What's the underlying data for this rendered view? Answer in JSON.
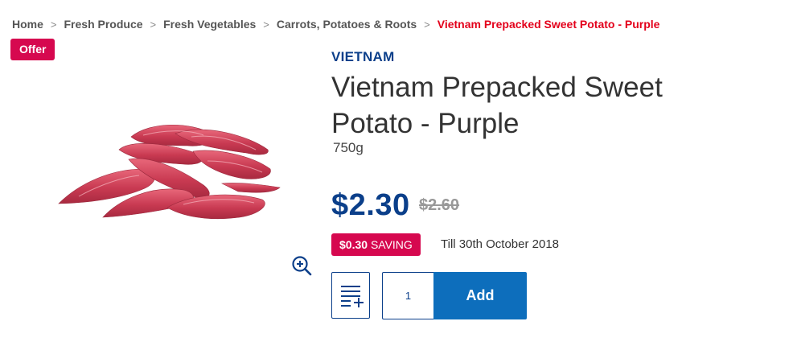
{
  "breadcrumb": {
    "items": [
      "Home",
      "Fresh Produce",
      "Fresh Vegetables",
      "Carrots, Potatoes & Roots"
    ],
    "current": "Vietnam Prepacked Sweet Potato - Purple",
    "separator": ">"
  },
  "offer_badge": "Offer",
  "product": {
    "origin": "VIETNAM",
    "title": "Vietnam Prepacked Sweet Potato - Purple",
    "size": "750g",
    "price": "$2.30",
    "old_price": "$2.60",
    "saving_amount": "$0.30",
    "saving_label": "SAVING",
    "saving_until": "Till 30th October 2018",
    "image_alt": "purple sweet potatoes"
  },
  "cart": {
    "quantity": "1",
    "add_label": "Add"
  },
  "icons": {
    "zoom": "zoom-in-icon",
    "list": "add-to-list-icon"
  },
  "colors": {
    "brand_blue": "#0b3f8a",
    "button_blue": "#0d6ebc",
    "offer_pink": "#d6084f",
    "breadcrumb_current": "#e3001b"
  }
}
